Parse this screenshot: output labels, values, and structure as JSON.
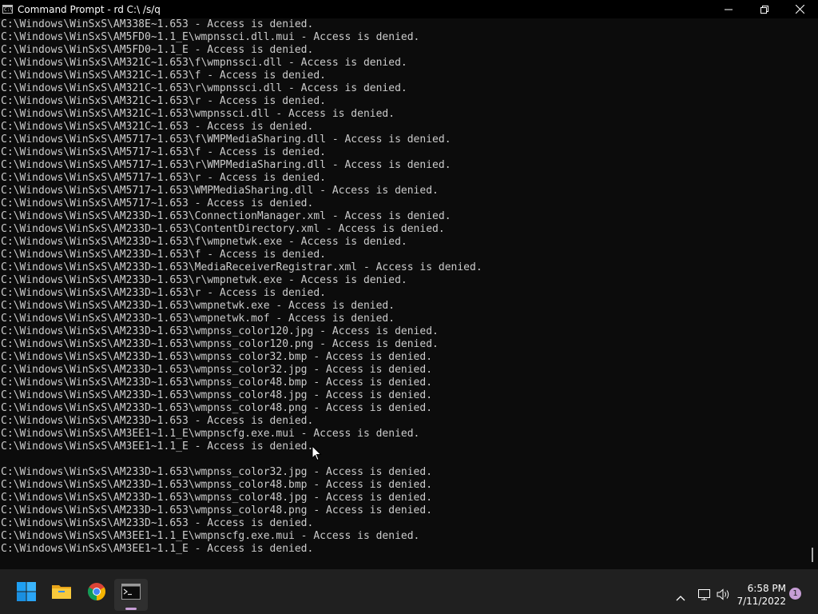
{
  "window": {
    "title": "Command Prompt - rd  C:\\ /s/q",
    "icon_glyph": "C:\\",
    "icon": "cmd-icon",
    "controls": [
      "minimize-icon",
      "restore-icon",
      "close-icon"
    ]
  },
  "console": {
    "lines": [
      "C:\\Windows\\WinSxS\\AM338E~1.653 - Access is denied.",
      "C:\\Windows\\WinSxS\\AM5FD0~1.1_E\\wmpnssci.dll.mui - Access is denied.",
      "C:\\Windows\\WinSxS\\AM5FD0~1.1_E - Access is denied.",
      "C:\\Windows\\WinSxS\\AM321C~1.653\\f\\wmpnssci.dll - Access is denied.",
      "C:\\Windows\\WinSxS\\AM321C~1.653\\f - Access is denied.",
      "C:\\Windows\\WinSxS\\AM321C~1.653\\r\\wmpnssci.dll - Access is denied.",
      "C:\\Windows\\WinSxS\\AM321C~1.653\\r - Access is denied.",
      "C:\\Windows\\WinSxS\\AM321C~1.653\\wmpnssci.dll - Access is denied.",
      "C:\\Windows\\WinSxS\\AM321C~1.653 - Access is denied.",
      "C:\\Windows\\WinSxS\\AM5717~1.653\\f\\WMPMediaSharing.dll - Access is denied.",
      "C:\\Windows\\WinSxS\\AM5717~1.653\\f - Access is denied.",
      "C:\\Windows\\WinSxS\\AM5717~1.653\\r\\WMPMediaSharing.dll - Access is denied.",
      "C:\\Windows\\WinSxS\\AM5717~1.653\\r - Access is denied.",
      "C:\\Windows\\WinSxS\\AM5717~1.653\\WMPMediaSharing.dll - Access is denied.",
      "C:\\Windows\\WinSxS\\AM5717~1.653 - Access is denied.",
      "C:\\Windows\\WinSxS\\AM233D~1.653\\ConnectionManager.xml - Access is denied.",
      "C:\\Windows\\WinSxS\\AM233D~1.653\\ContentDirectory.xml - Access is denied.",
      "C:\\Windows\\WinSxS\\AM233D~1.653\\f\\wmpnetwk.exe - Access is denied.",
      "C:\\Windows\\WinSxS\\AM233D~1.653\\f - Access is denied.",
      "C:\\Windows\\WinSxS\\AM233D~1.653\\MediaReceiverRegistrar.xml - Access is denied.",
      "C:\\Windows\\WinSxS\\AM233D~1.653\\r\\wmpnetwk.exe - Access is denied.",
      "C:\\Windows\\WinSxS\\AM233D~1.653\\r - Access is denied.",
      "C:\\Windows\\WinSxS\\AM233D~1.653\\wmpnetwk.exe - Access is denied.",
      "C:\\Windows\\WinSxS\\AM233D~1.653\\wmpnetwk.mof - Access is denied.",
      "C:\\Windows\\WinSxS\\AM233D~1.653\\wmpnss_color120.jpg - Access is denied.",
      "C:\\Windows\\WinSxS\\AM233D~1.653\\wmpnss_color120.png - Access is denied.",
      "C:\\Windows\\WinSxS\\AM233D~1.653\\wmpnss_color32.bmp - Access is denied.",
      "C:\\Windows\\WinSxS\\AM233D~1.653\\wmpnss_color32.jpg - Access is denied.",
      "C:\\Windows\\WinSxS\\AM233D~1.653\\wmpnss_color48.bmp - Access is denied.",
      "C:\\Windows\\WinSxS\\AM233D~1.653\\wmpnss_color48.jpg - Access is denied.",
      "C:\\Windows\\WinSxS\\AM233D~1.653\\wmpnss_color48.png - Access is denied.",
      "C:\\Windows\\WinSxS\\AM233D~1.653 - Access is denied.",
      "C:\\Windows\\WinSxS\\AM3EE1~1.1_E\\wmpnscfg.exe.mui - Access is denied.",
      "C:\\Windows\\WinSxS\\AM3EE1~1.1_E - Access is denied.",
      "",
      "C:\\Windows\\WinSxS\\AM233D~1.653\\wmpnss_color32.jpg - Access is denied.",
      "C:\\Windows\\WinSxS\\AM233D~1.653\\wmpnss_color48.bmp - Access is denied.",
      "C:\\Windows\\WinSxS\\AM233D~1.653\\wmpnss_color48.jpg - Access is denied.",
      "C:\\Windows\\WinSxS\\AM233D~1.653\\wmpnss_color48.png - Access is denied.",
      "C:\\Windows\\WinSxS\\AM233D~1.653 - Access is denied.",
      "C:\\Windows\\WinSxS\\AM3EE1~1.1_E\\wmpnscfg.exe.mui - Access is denied.",
      "C:\\Windows\\WinSxS\\AM3EE1~1.1_E - Access is denied."
    ],
    "text_color": "#cccccc",
    "background": "#0c0c0c"
  },
  "taskbar": {
    "background": "#202020",
    "apps": [
      {
        "name": "start",
        "icon": "windows-start-icon"
      },
      {
        "name": "file-explorer",
        "icon": "folder-icon"
      },
      {
        "name": "chrome",
        "icon": "chrome-icon"
      },
      {
        "name": "terminal",
        "icon": "terminal-icon",
        "active": true
      }
    ],
    "tray_icons": [
      "chevron-up-icon",
      "network-icon",
      "volume-icon"
    ],
    "time": "6:58 PM",
    "date": "7/11/2022",
    "notification_count": "1",
    "accent": "#c79ed6"
  }
}
